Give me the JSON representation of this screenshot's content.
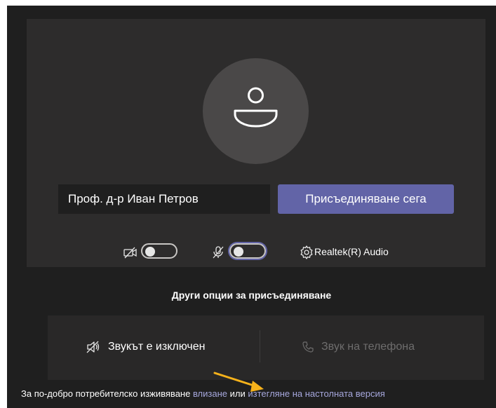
{
  "prejoin": {
    "name_value": "Проф. д-р Иван Петров",
    "join_label": "Присъединяване сега",
    "video_toggle": {
      "state": "off"
    },
    "mic_toggle": {
      "state": "off"
    },
    "device_label": "Realtek(R) Audio"
  },
  "other_options": {
    "title": "Други опции за присъединяване",
    "audio_off_label": "Звукът е изключен",
    "phone_audio_label": "Звук на телефона"
  },
  "footer": {
    "text_before": "За по-добро потребителско изживяване ",
    "signin_link": "влизане",
    "text_middle": " или ",
    "download_link": "изтегляне на настолната версия"
  },
  "colors": {
    "accent": "#6264a7",
    "link": "#a6a7dc",
    "annotation_arrow": "#f6b21b"
  },
  "icons": [
    "avatar-icon",
    "camera-off-icon",
    "mic-off-icon",
    "gear-icon",
    "speaker-off-icon",
    "phone-icon",
    "annotation-arrow"
  ]
}
